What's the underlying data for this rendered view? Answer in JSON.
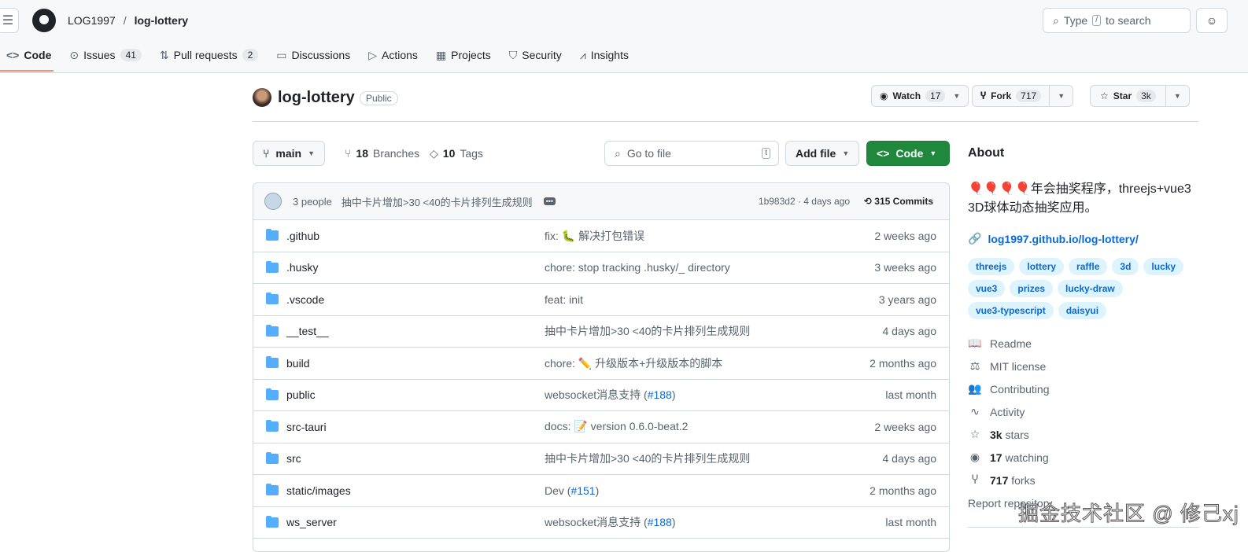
{
  "header": {
    "owner": "LOG1997",
    "separator": "/",
    "repo": "log-lottery",
    "search_placeholder_pre": "Type",
    "search_key": "/",
    "search_placeholder_post": "to search"
  },
  "tabs": [
    {
      "label": "Code",
      "icon": "code-icon"
    },
    {
      "label": "Issues",
      "count": "41",
      "icon": "issue-icon"
    },
    {
      "label": "Pull requests",
      "count": "2",
      "icon": "pull-request-icon"
    },
    {
      "label": "Discussions",
      "icon": "discussion-icon"
    },
    {
      "label": "Actions",
      "icon": "play-icon"
    },
    {
      "label": "Projects",
      "icon": "table-icon"
    },
    {
      "label": "Security",
      "icon": "shield-icon"
    },
    {
      "label": "Insights",
      "icon": "graph-icon"
    }
  ],
  "repo": {
    "name": "log-lottery",
    "visibility": "Public",
    "watch": "Watch",
    "watch_count": "17",
    "fork": "Fork",
    "fork_count": "717",
    "star": "Star",
    "star_count": "3k"
  },
  "toolbar": {
    "branch": "main",
    "branches_count": "18",
    "branches_label": "Branches",
    "tags_count": "10",
    "tags_label": "Tags",
    "goto_placeholder": "Go to file",
    "goto_key": "t",
    "add_file": "Add file",
    "code": "Code"
  },
  "commit": {
    "authors": "3 people",
    "message": "抽中卡片增加>30 <40的卡片排列生成规则",
    "hash_time": "1b983d2 · 4 days ago",
    "commits": "315 Commits"
  },
  "files": [
    {
      "name": ".github",
      "msg": "fix: 🐛 解决打包错误",
      "date": "2 weeks ago"
    },
    {
      "name": ".husky",
      "msg": "chore: stop tracking .husky/_ directory",
      "date": "3 weeks ago"
    },
    {
      "name": ".vscode",
      "msg": "feat: init",
      "date": "3 years ago"
    },
    {
      "name": "__test__",
      "msg": "抽中卡片增加>30 <40的卡片排列生成规则",
      "date": "4 days ago"
    },
    {
      "name": "build",
      "msg": "chore: ✏️ 升级版本+升级版本的脚本",
      "date": "2 months ago"
    },
    {
      "name": "public",
      "msg": "websocket消息支持 (",
      "link": "#188",
      "msg_end": ")",
      "date": "last month"
    },
    {
      "name": "src-tauri",
      "msg": "docs: 📝 version 0.6.0-beat.2",
      "date": "2 weeks ago"
    },
    {
      "name": "src",
      "msg": "抽中卡片增加>30 <40的卡片排列生成规则",
      "date": "4 days ago"
    },
    {
      "name": "static/images",
      "msg": "Dev (",
      "link": "#151",
      "msg_end": ")",
      "date": "2 months ago"
    },
    {
      "name": "ws_server",
      "msg": "websocket消息支持 (",
      "link": "#188",
      "msg_end": ")",
      "date": "last month"
    }
  ],
  "about": {
    "title": "About",
    "description": "🎈🎈🎈🎈年会抽奖程序，threejs+vue3 3D球体动态抽奖应用。",
    "website": "log1997.github.io/log-lottery/",
    "topics": [
      "threejs",
      "lottery",
      "raffle",
      "3d",
      "lucky",
      "vue3",
      "prizes",
      "lucky-draw",
      "vue3-typescript",
      "daisyui"
    ],
    "meta": [
      {
        "icon": "book-icon",
        "bold": "",
        "label": "Readme",
        "glyph": "📖"
      },
      {
        "icon": "law-icon",
        "bold": "",
        "label": "MIT license",
        "glyph": "⚖"
      },
      {
        "icon": "people-icon",
        "bold": "",
        "label": "Contributing",
        "glyph": "👥"
      },
      {
        "icon": "pulse-icon",
        "bold": "",
        "label": "Activity",
        "glyph": "∿"
      },
      {
        "icon": "star-icon",
        "bold": "3k",
        "label": " stars",
        "glyph": "☆"
      },
      {
        "icon": "eye-icon",
        "bold": "17",
        "label": " watching",
        "glyph": "◉"
      },
      {
        "icon": "fork-icon",
        "bold": "717",
        "label": " forks",
        "glyph": "Ⴤ"
      }
    ],
    "report": "Report repository"
  },
  "watermark": "掘金技术社区 @ 修己xj"
}
